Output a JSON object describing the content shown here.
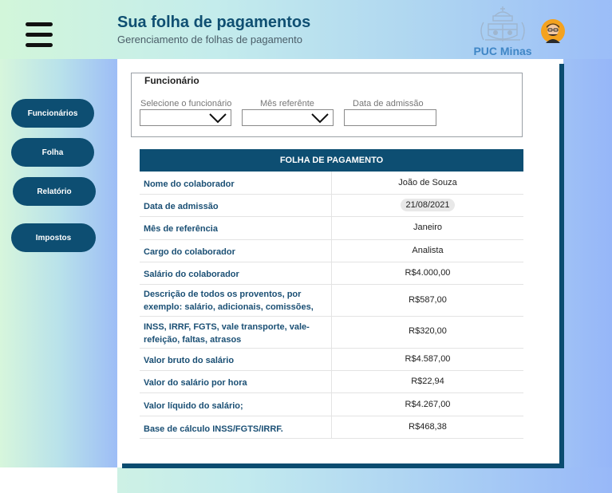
{
  "header": {
    "title": "Sua folha de pagamentos",
    "subtitle": "Gerenciamento de folhas de pagamento",
    "logo_text": "PUC Minas"
  },
  "sidebar": {
    "items": [
      {
        "label": "Funcionários"
      },
      {
        "label": "Folha"
      },
      {
        "label": "Relatório"
      },
      {
        "label": "Impostos"
      }
    ]
  },
  "filter": {
    "title": "Funcionário",
    "employee_label": "Selecione o funcionário",
    "month_label": "Mês referênte",
    "admission_label": "Data de admissão",
    "employee_value": "",
    "month_value": "",
    "admission_value": ""
  },
  "payroll": {
    "title": "FOLHA DE PAGAMENTO",
    "rows": [
      {
        "label": "Nome do colaborador",
        "value": "João de Souza"
      },
      {
        "label": "Data de admissão",
        "value": "21/08/2021"
      },
      {
        "label": "Mês de referência",
        "value": "Janeiro"
      },
      {
        "label": "Cargo do colaborador",
        "value": "Analista"
      },
      {
        "label": "Salário do colaborador",
        "value": "R$4.000,00"
      },
      {
        "label": "Descrição de todos os proventos, por exemplo: salário, adicionais, comissões,",
        "value": "R$587,00"
      },
      {
        "label": "INSS, IRRF, FGTS, vale transporte, vale-refeição, faltas, atrasos",
        "value": "R$320,00"
      },
      {
        "label": "Valor bruto do salário",
        "value": "R$4.587,00"
      },
      {
        "label": "Valor do salário por hora",
        "value": "R$22,94"
      },
      {
        "label": "Valor líquido do salário;",
        "value": "R$4.267,00"
      },
      {
        "label": "Base de cálculo INSS/FGTS/IRRF.",
        "value": "R$468,38"
      }
    ]
  },
  "colors": {
    "primary": "#0d4e72",
    "label_text": "#1a4f74",
    "logo": "#3f86c6"
  }
}
